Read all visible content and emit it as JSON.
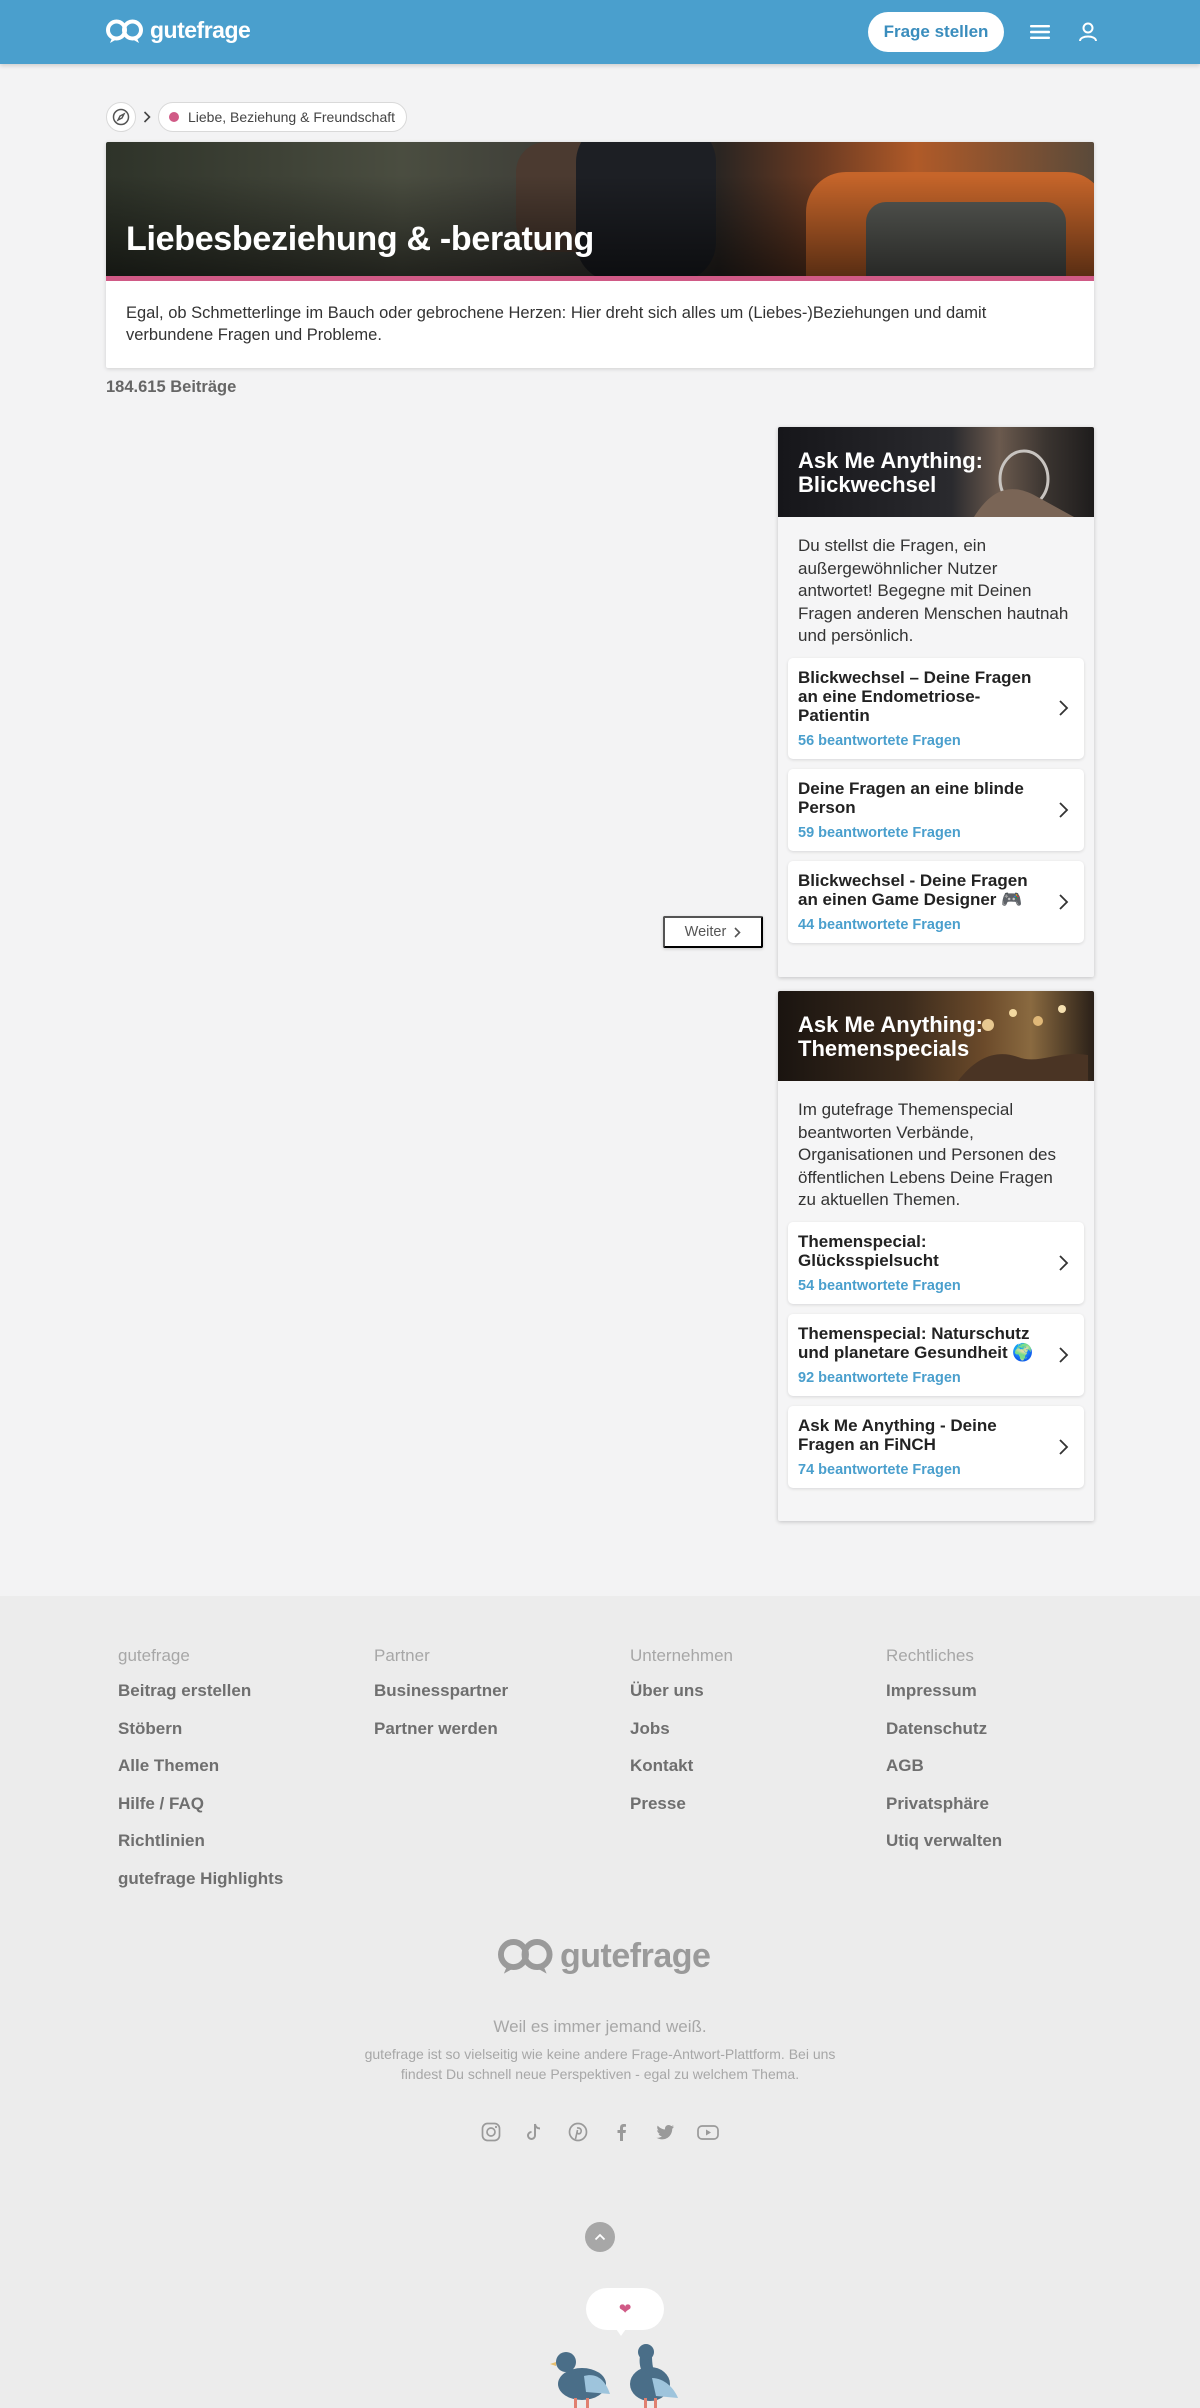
{
  "header": {
    "logo_text": "gutefrage",
    "ask_button": "Frage stellen"
  },
  "breadcrumb": {
    "category": "Liebe, Beziehung & Freundschaft"
  },
  "hero": {
    "title": "Liebesbeziehung & -beratung",
    "description": "Egal, ob Schmetterlinge im Bauch oder gebrochene Herzen: Hier dreht sich alles um (Liebes-)Beziehungen und damit verbundene Fragen und Probleme."
  },
  "post_count": "184.615 Beiträge",
  "pager": {
    "next_label": "Weiter"
  },
  "ama_blickwechsel": {
    "title": "Ask Me Anything: Blickwechsel",
    "description": "Du stellst die Fragen, ein außergewöhnlicher Nutzer antwortet! Begegne mit Deinen Fragen anderen Menschen hautnah und persönlich.",
    "items": [
      {
        "title": "Blickwechsel – Deine Fragen an eine Endometriose-Patientin",
        "count": "56 beantwortete Fragen"
      },
      {
        "title": "Deine Fragen an eine blinde Person",
        "count": "59 beantwortete Fragen"
      },
      {
        "title": "Blickwechsel - Deine Fragen an einen Game Designer 🎮",
        "count": "44 beantwortete Fragen"
      }
    ]
  },
  "ama_themenspecials": {
    "title": "Ask Me Anything: Themenspecials",
    "description": "Im gutefrage Themenspecial beantworten Verbände, Organisationen und Personen des öffentlichen Lebens Deine Fragen zu aktuellen Themen.",
    "items": [
      {
        "title": "Themenspecial: Glücksspielsucht",
        "count": "54 beantwortete Fragen"
      },
      {
        "title": "Themenspecial: Naturschutz und planetare Gesundheit 🌍",
        "count": "92 beantwortete Fragen"
      },
      {
        "title": "Ask Me Anything - Deine Fragen an FiNCH",
        "count": "74 beantwortete Fragen"
      }
    ]
  },
  "footer": {
    "columns": [
      {
        "heading": "gutefrage",
        "links": [
          "Beitrag erstellen",
          "Stöbern",
          "Alle Themen",
          "Hilfe / FAQ",
          "Richtlinien",
          "gutefrage Highlights"
        ]
      },
      {
        "heading": "Partner",
        "links": [
          "Businesspartner",
          "Partner werden"
        ]
      },
      {
        "heading": "Unternehmen",
        "links": [
          "Über uns",
          "Jobs",
          "Kontakt",
          "Presse"
        ]
      },
      {
        "heading": "Rechtliches",
        "links": [
          "Impressum",
          "Datenschutz",
          "AGB",
          "Privatsphäre",
          "Utiq verwalten"
        ]
      }
    ],
    "logo_text": "gutefrage",
    "tagline": "Weil es immer jemand weiß.",
    "subline": "gutefrage ist so vielseitig wie keine andere Frage-Antwort-Plattform. Bei uns findest Du schnell neue Perspektiven - egal zu welchem Thema.",
    "social_icons": [
      "instagram-icon",
      "tiktok-icon",
      "pinterest-icon",
      "facebook-icon",
      "twitter-icon",
      "youtube-icon"
    ],
    "heart_glyph": "❤"
  },
  "colors": {
    "brand_blue": "#4a9fcd",
    "category_pink": "#d05a86",
    "link_blue": "#4a9fcd"
  }
}
